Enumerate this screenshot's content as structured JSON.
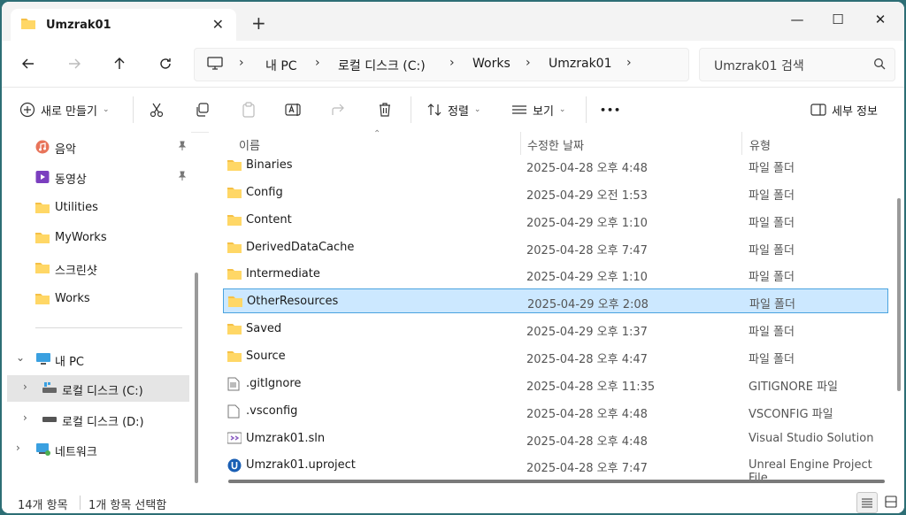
{
  "window": {
    "tab_title": "Umzrak01",
    "tab_close": "✕",
    "new_tab": "+",
    "minimize": "—",
    "maximize": "☐",
    "close": "✕"
  },
  "address": {
    "breadcrumbs": [
      "내 PC",
      "로컬 디스크 (C:)",
      "Works",
      "Umzrak01"
    ],
    "search_placeholder": "Umzrak01 검색"
  },
  "commands": {
    "new": "새로 만들기",
    "sort": "정렬",
    "view": "보기",
    "more": "•••",
    "details": "세부 정보"
  },
  "sidebar": {
    "items": [
      {
        "label": "음악",
        "icon": "music-icon"
      },
      {
        "label": "동영상",
        "icon": "video-icon"
      },
      {
        "label": "Utilities",
        "icon": "folder-icon"
      },
      {
        "label": "MyWorks",
        "icon": "folder-icon"
      },
      {
        "label": "스크린샷",
        "icon": "folder-icon"
      },
      {
        "label": "Works",
        "icon": "folder-icon"
      },
      {
        "label": "내 PC",
        "icon": "pc-icon"
      },
      {
        "label": "로컬 디스크 (C:)",
        "icon": "drive-icon"
      },
      {
        "label": "로컬 디스크 (D:)",
        "icon": "drive-icon"
      },
      {
        "label": "네트워크",
        "icon": "network-icon"
      }
    ]
  },
  "columns": {
    "name": "이름",
    "date": "수정한 날짜",
    "type": "유형"
  },
  "files": [
    {
      "name": "Binaries",
      "date": "2025-04-28 오후 4:48",
      "type": "파일 폴더",
      "icon": "folder-icon"
    },
    {
      "name": "Config",
      "date": "2025-04-29 오전 1:53",
      "type": "파일 폴더",
      "icon": "folder-icon"
    },
    {
      "name": "Content",
      "date": "2025-04-29 오후 1:10",
      "type": "파일 폴더",
      "icon": "folder-icon"
    },
    {
      "name": "DerivedDataCache",
      "date": "2025-04-28 오후 7:47",
      "type": "파일 폴더",
      "icon": "folder-icon"
    },
    {
      "name": "Intermediate",
      "date": "2025-04-29 오후 1:10",
      "type": "파일 폴더",
      "icon": "folder-icon"
    },
    {
      "name": "OtherResources",
      "date": "2025-04-29 오후 2:08",
      "type": "파일 폴더",
      "icon": "folder-icon"
    },
    {
      "name": "Saved",
      "date": "2025-04-29 오후 1:37",
      "type": "파일 폴더",
      "icon": "folder-icon"
    },
    {
      "name": "Source",
      "date": "2025-04-28 오후 4:47",
      "type": "파일 폴더",
      "icon": "folder-icon"
    },
    {
      "name": ".gitIgnore",
      "date": "2025-04-28 오후 11:35",
      "type": "GITIGNORE 파일",
      "icon": "text-file-icon"
    },
    {
      "name": ".vsconfig",
      "date": "2025-04-28 오후 4:48",
      "type": "VSCONFIG 파일",
      "icon": "blank-file-icon"
    },
    {
      "name": "Umzrak01.sln",
      "date": "2025-04-28 오후 4:48",
      "type": "Visual Studio Solution",
      "icon": "visual-studio-icon"
    },
    {
      "name": "Umzrak01.uproject",
      "date": "2025-04-28 오후 7:47",
      "type": "Unreal Engine Project File",
      "icon": "unreal-icon"
    }
  ],
  "status": {
    "count": "14개 항목",
    "selected": "1개 항목 선택함"
  }
}
